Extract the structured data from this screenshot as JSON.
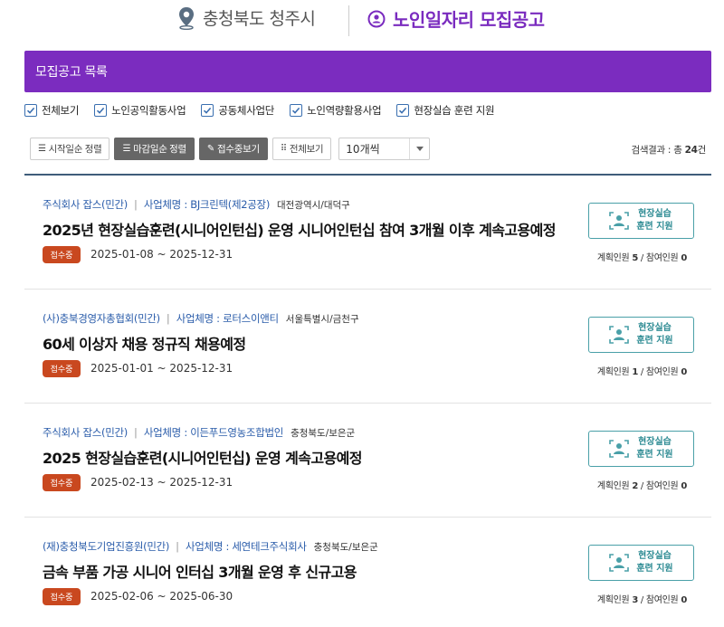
{
  "header": {
    "location": "충청북도 청주시",
    "title": "노인일자리 모집공고"
  },
  "banner": {
    "label": "모집공고 목록"
  },
  "filters": [
    {
      "label": "전체보기",
      "checked": true
    },
    {
      "label": "노인공익활동사업",
      "checked": true
    },
    {
      "label": "공동체사업단",
      "checked": true
    },
    {
      "label": "노인역량활용사업",
      "checked": true
    },
    {
      "label": "현장실습 훈련 지원",
      "checked": true
    }
  ],
  "toolbar": {
    "sort_start": "시작일순 정렬",
    "sort_end": "마감일순 정렬",
    "receiving": "접수중보기",
    "view_all": "전체보기",
    "page_size": "10개씩"
  },
  "result": {
    "prefix": "검색결과 : 총 ",
    "count": "24",
    "suffix": "건"
  },
  "listings": [
    {
      "org": "주식회사 잡스(민간)",
      "business": "사업체명 : BJ크린텍(제2공장)",
      "region": "대전광역시/대덕구",
      "title": "2025년 현장실습훈련(시니어인턴십) 운영 시니어인턴십 참여 3개월 이후 계속고용예정",
      "status": "접수중",
      "period": "2025-01-08 ~ 2025-12-31",
      "badge_line1": "현장실습",
      "badge_line2": "훈련 지원",
      "planned_label": "계획인원",
      "planned": "5",
      "joined_label": "참여인원",
      "joined": "0"
    },
    {
      "org": "(사)충북경영자총협회(민간)",
      "business": "사업체명 : 로터스이앤티",
      "region": "서울특별시/금천구",
      "title": "60세 이상자 채용 정규직 채용예정",
      "status": "접수중",
      "period": "2025-01-01 ~ 2025-12-31",
      "badge_line1": "현장실습",
      "badge_line2": "훈련 지원",
      "planned_label": "계획인원",
      "planned": "1",
      "joined_label": "참여인원",
      "joined": "0"
    },
    {
      "org": "주식회사 잡스(민간)",
      "business": "사업체명 : 이든푸드영농조합법인",
      "region": "충청북도/보은군",
      "title": "2025 현장실습훈련(시니어인턴십) 운영 계속고용예정",
      "status": "접수중",
      "period": "2025-02-13 ~ 2025-12-31",
      "badge_line1": "현장실습",
      "badge_line2": "훈련 지원",
      "planned_label": "계획인원",
      "planned": "2",
      "joined_label": "참여인원",
      "joined": "0"
    },
    {
      "org": "(재)충청북도기업진흥원(민간)",
      "business": "사업체명 : 세연테크주식회사",
      "region": "충청북도/보은군",
      "title": "금속 부품 가공 시니어 인터십 3개월 운영 후 신규고용",
      "status": "접수중",
      "period": "2025-02-06 ~ 2025-06-30",
      "badge_line1": "현장실습",
      "badge_line2": "훈련 지원",
      "planned_label": "계획인원",
      "planned": "3",
      "joined_label": "참여인원",
      "joined": "0"
    }
  ],
  "colors": {
    "brand_purple": "#7b2cbf",
    "status_orange": "#c9481f",
    "badge_teal": "#4aa0a8",
    "link_blue": "#2a5caa"
  },
  "icons": {
    "location": "map-pin-icon",
    "title": "person-circle-icon",
    "badge": "person-training-icon"
  }
}
